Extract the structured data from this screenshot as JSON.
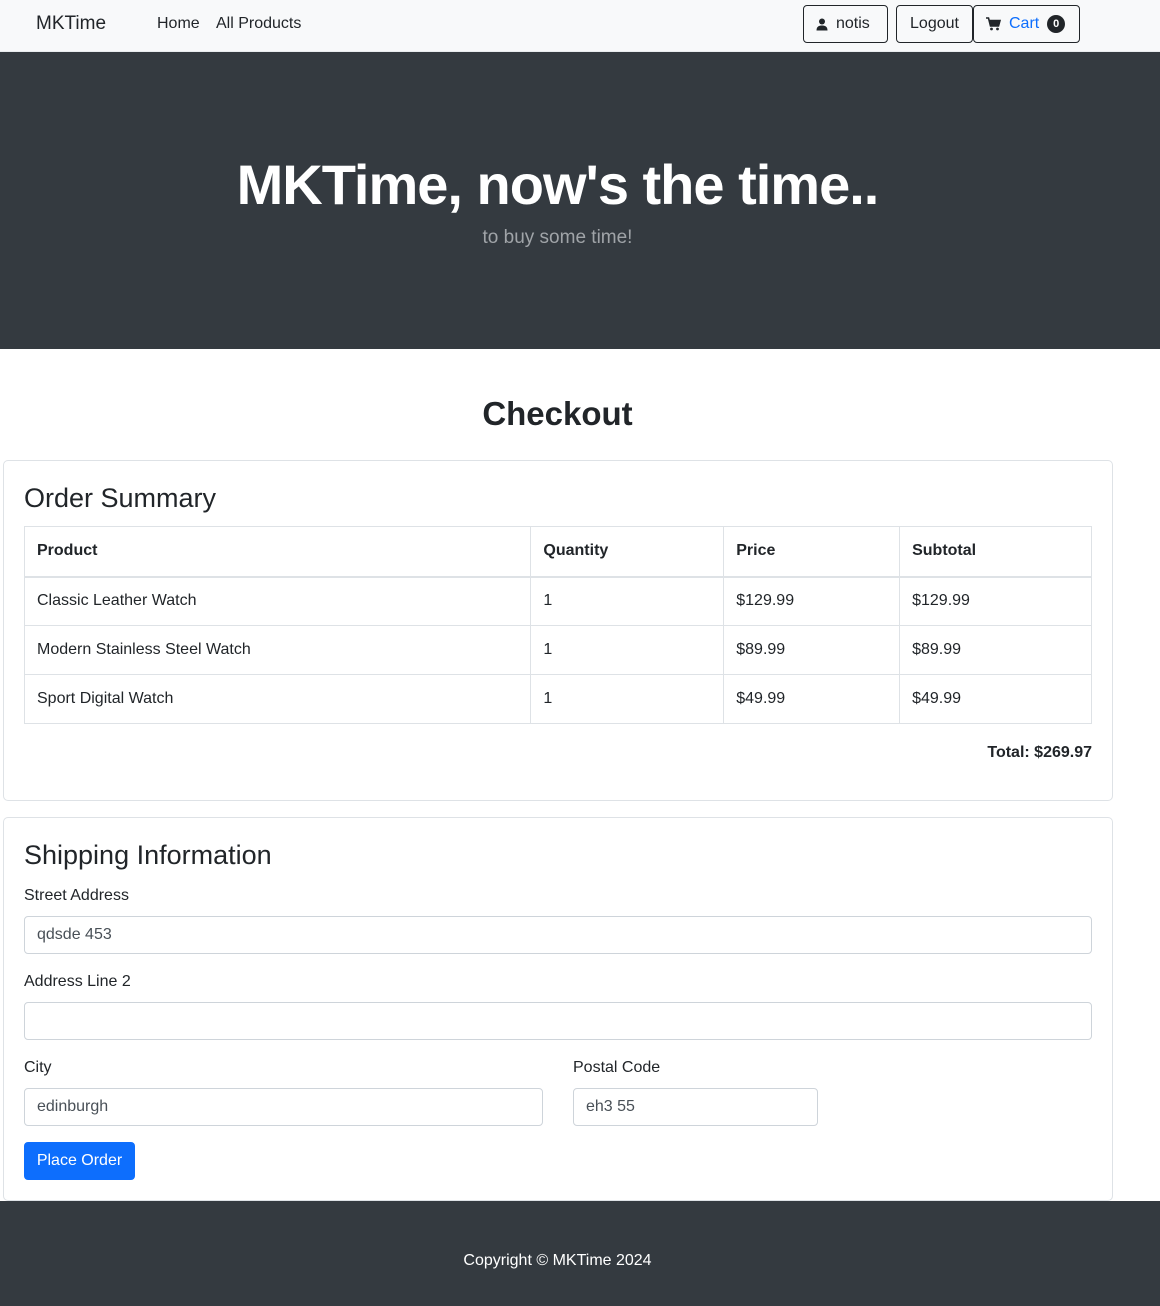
{
  "navbar": {
    "brand": "MKTime",
    "links": {
      "home": "Home",
      "all_products": "All Products"
    },
    "user_label": "notis",
    "logout_label": "Logout",
    "cart_label": "Cart",
    "cart_count": "0"
  },
  "hero": {
    "title": "MKTime, now's the time..",
    "subtitle": "to buy some time!"
  },
  "checkout": {
    "title": "Checkout",
    "order_summary": {
      "heading": "Order Summary",
      "columns": [
        "Product",
        "Quantity",
        "Price",
        "Subtotal"
      ],
      "rows": [
        [
          "Classic Leather Watch",
          "1",
          "$129.99",
          "$129.99"
        ],
        [
          "Modern Stainless Steel Watch",
          "1",
          "$89.99",
          "$89.99"
        ],
        [
          "Sport Digital Watch",
          "1",
          "$49.99",
          "$49.99"
        ]
      ],
      "total": "Total: $269.97"
    },
    "shipping": {
      "heading": "Shipping Information",
      "street_label": "Street Address",
      "street_value": "qdsde 453",
      "line2_label": "Address Line 2",
      "line2_value": "",
      "city_label": "City",
      "city_value": "edinburgh",
      "postal_label": "Postal Code",
      "postal_value": "eh3 55",
      "submit_label": "Place Order"
    }
  },
  "footer": {
    "copyright": "Copyright © MKTime 2024"
  },
  "colors": {
    "primary": "#0d6efd",
    "dark": "#343a40",
    "navbar_bg": "#f8f9fa"
  }
}
